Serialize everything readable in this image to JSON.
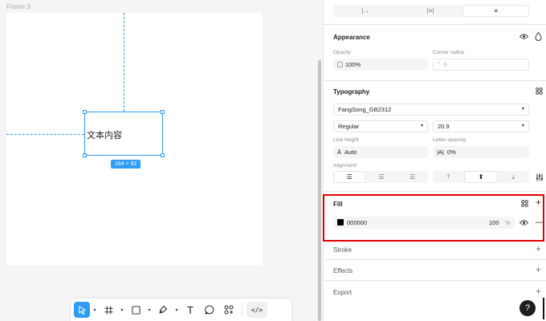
{
  "canvas": {
    "frame_label": "Frame 3",
    "text_content": "文本内容",
    "size_badge": "164 × 92"
  },
  "toolbar": {
    "tools": [
      "move",
      "frame",
      "rectangle",
      "pen",
      "text",
      "comment",
      "assets",
      "dev-mode"
    ],
    "text_tool_glyph": "T",
    "code_glyph": "</>"
  },
  "panel": {
    "top_tabs": [
      "|→",
      "|≡|",
      "≡"
    ],
    "appearance": {
      "title": "Appearance",
      "opacity_label": "Opacity",
      "opacity_value": "100%",
      "corner_radius_label": "Corner radius",
      "corner_radius_value": "0"
    },
    "typography": {
      "title": "Typography",
      "font_family": "FangSong_GB2312",
      "font_weight": "Regular",
      "font_size": "20.9",
      "line_height_label": "Line height",
      "line_height_value": "Auto",
      "letter_spacing_label": "Letter spacing",
      "letter_spacing_value": "0%",
      "alignment_label": "Alignment"
    },
    "fill": {
      "title": "Fill",
      "color_hex": "000000",
      "opacity": "100",
      "unit": "%"
    },
    "stroke_title": "Stroke",
    "effects_title": "Effects",
    "export_title": "Export",
    "help_glyph": "?"
  },
  "colors": {
    "accent": "#2f9df4",
    "highlight": "#e00000",
    "fill_swatch": "#000000"
  }
}
